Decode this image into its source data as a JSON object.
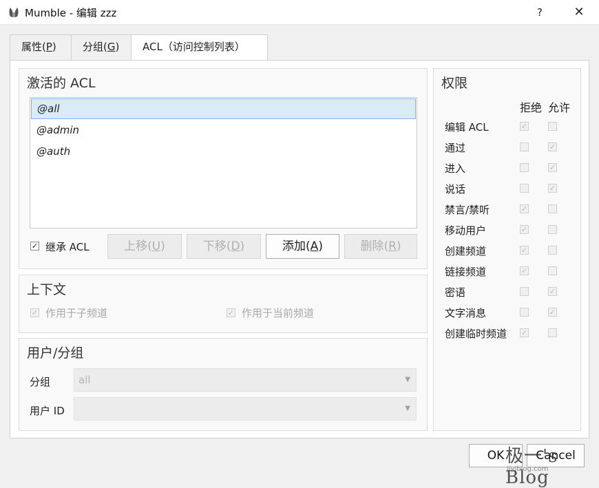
{
  "window": {
    "title": "Mumble - 编辑 zzz",
    "help_label": "?",
    "close_label": "✕"
  },
  "tabs": [
    {
      "label": "属性(",
      "mnemonic": "P",
      "suffix": ")",
      "active": false
    },
    {
      "label": "分组(",
      "mnemonic": "G",
      "suffix": ")",
      "active": false
    },
    {
      "label": "ACL（访问控制列表）",
      "mnemonic": "",
      "suffix": "",
      "active": true
    }
  ],
  "active_acl": {
    "title": "激活的 ACL",
    "items": [
      "@all",
      "@admin",
      "@auth"
    ],
    "selected_index": 0,
    "inherit_label": "继承 ACL",
    "inherit_checked": true,
    "buttons": {
      "up": {
        "label": "上移(",
        "mnemonic": "U",
        "suffix": ")"
      },
      "down": {
        "label": "下移(",
        "mnemonic": "D",
        "suffix": ")"
      },
      "add": {
        "label": "添加(",
        "mnemonic": "A",
        "suffix": ")"
      },
      "remove": {
        "label": "删除(",
        "mnemonic": "R",
        "suffix": ")"
      }
    }
  },
  "context": {
    "title": "上下文",
    "apply_subchannels_label": "作用于子频道",
    "apply_current_label": "作用于当前频道"
  },
  "user_group": {
    "title": "用户/分组",
    "group_label": "分组",
    "group_value": "all",
    "user_id_label": "用户 ID",
    "user_id_value": ""
  },
  "permissions": {
    "title": "权限",
    "deny_header": "拒绝",
    "allow_header": "允许",
    "rows": [
      {
        "label": "编辑 ACL",
        "deny": true,
        "allow": false
      },
      {
        "label": "通过",
        "deny": false,
        "allow": true
      },
      {
        "label": "进入",
        "deny": false,
        "allow": true
      },
      {
        "label": "说话",
        "deny": false,
        "allow": true
      },
      {
        "label": "禁言/禁听",
        "deny": true,
        "allow": false
      },
      {
        "label": "移动用户",
        "deny": true,
        "allow": false
      },
      {
        "label": "创建频道",
        "deny": true,
        "allow": false
      },
      {
        "label": "链接频道",
        "deny": true,
        "allow": false
      },
      {
        "label": "密语",
        "deny": false,
        "allow": true
      },
      {
        "label": "文字消息",
        "deny": false,
        "allow": true
      },
      {
        "label": "创建临时频道",
        "deny": true,
        "allow": false
      }
    ]
  },
  "dialog_buttons": {
    "ok": "OK",
    "cancel": "Cancel"
  },
  "watermark": {
    "text": "极一's Blog",
    "sub": "jiyiblog.com"
  }
}
